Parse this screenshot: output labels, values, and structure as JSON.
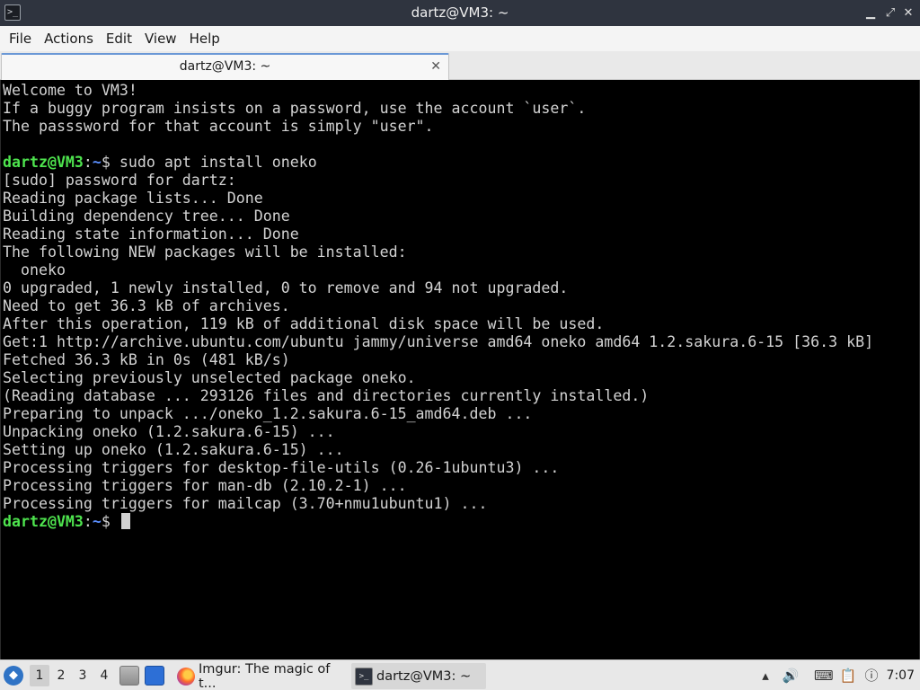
{
  "window": {
    "title": "dartz@VM3: ~",
    "minimize_glyph": "▁",
    "maximize_glyph": "⤢",
    "close_glyph": "✕"
  },
  "menu": [
    "File",
    "Actions",
    "Edit",
    "View",
    "Help"
  ],
  "tab": {
    "label": "dartz@VM3: ~",
    "close_glyph": "✕"
  },
  "terminal": {
    "prompt_user": "dartz@VM3",
    "prompt_sep": ":",
    "prompt_path": "~",
    "prompt_symbol": "$",
    "lines": [
      {
        "kind": "text",
        "text": "Welcome to VM3!"
      },
      {
        "kind": "text",
        "text": "If a buggy program insists on a password, use the account `user`."
      },
      {
        "kind": "text",
        "text": "The passsword for that account is simply \"user\"."
      },
      {
        "kind": "text",
        "text": ""
      },
      {
        "kind": "prompt",
        "command": " sudo apt install oneko"
      },
      {
        "kind": "text",
        "text": "[sudo] password for dartz:"
      },
      {
        "kind": "text",
        "text": "Reading package lists... Done"
      },
      {
        "kind": "text",
        "text": "Building dependency tree... Done"
      },
      {
        "kind": "text",
        "text": "Reading state information... Done"
      },
      {
        "kind": "text",
        "text": "The following NEW packages will be installed:"
      },
      {
        "kind": "text",
        "text": "  oneko"
      },
      {
        "kind": "text",
        "text": "0 upgraded, 1 newly installed, 0 to remove and 94 not upgraded."
      },
      {
        "kind": "text",
        "text": "Need to get 36.3 kB of archives."
      },
      {
        "kind": "text",
        "text": "After this operation, 119 kB of additional disk space will be used."
      },
      {
        "kind": "text",
        "text": "Get:1 http://archive.ubuntu.com/ubuntu jammy/universe amd64 oneko amd64 1.2.sakura.6-15 [36.3 kB]"
      },
      {
        "kind": "text",
        "text": "Fetched 36.3 kB in 0s (481 kB/s)"
      },
      {
        "kind": "text",
        "text": "Selecting previously unselected package oneko."
      },
      {
        "kind": "text",
        "text": "(Reading database ... 293126 files and directories currently installed.)"
      },
      {
        "kind": "text",
        "text": "Preparing to unpack .../oneko_1.2.sakura.6-15_amd64.deb ..."
      },
      {
        "kind": "text",
        "text": "Unpacking oneko (1.2.sakura.6-15) ..."
      },
      {
        "kind": "text",
        "text": "Setting up oneko (1.2.sakura.6-15) ..."
      },
      {
        "kind": "text",
        "text": "Processing triggers for desktop-file-utils (0.26-1ubuntu3) ..."
      },
      {
        "kind": "text",
        "text": "Processing triggers for man-db (2.10.2-1) ..."
      },
      {
        "kind": "text",
        "text": "Processing triggers for mailcap (3.70+nmu1ubuntu1) ..."
      },
      {
        "kind": "prompt",
        "command": " ",
        "cursor": true
      }
    ]
  },
  "taskbar": {
    "workspaces": [
      "1",
      "2",
      "3",
      "4"
    ],
    "active_workspace": "1",
    "tasks": [
      {
        "label": "Imgur: The magic of t...",
        "icon": "firefox-icon"
      },
      {
        "label": "dartz@VM3: ~",
        "icon": "terminal-icon",
        "active": true
      }
    ],
    "clock": "7:07",
    "colors": {
      "start": "#2f73c5",
      "prompt_user": "#4ee44e",
      "prompt_path": "#5b8fff"
    }
  }
}
